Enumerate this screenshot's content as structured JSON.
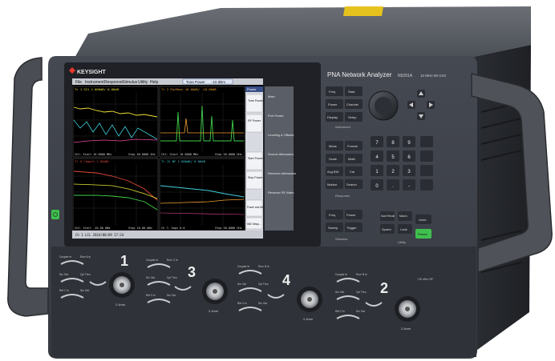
{
  "brand": "KEYSIGHT",
  "model": {
    "name": "PNA Network Analyzer",
    "number": "N5291A",
    "range": "10 MHz-50 GHz"
  },
  "screen": {
    "menu": [
      "File",
      "Instrument",
      "Response",
      "Stimulus",
      "Utility",
      "Help"
    ],
    "power_field": {
      "label": "Tone Power",
      "value": "-10 dBm"
    },
    "softkey_header": {
      "title": "Power",
      "selector": "IMD"
    },
    "softkeys": [
      "Tone Power",
      "RF Power",
      "Start Power",
      "Stop Power",
      "Power and Attenuators...",
      "IMD Setup..."
    ],
    "side_labels": [
      "Main",
      "Port Power",
      "Leveling & Offsets",
      "Source Attenuator",
      "Receiver Attenuator",
      "Receiver RF Atten"
    ],
    "panels": [
      {
        "title": "Tr 1 S21 1.000dB/ 0.00dB",
        "footer": "Ch1: Start 10.0000 MHz",
        "stop": "Stop 50.0000 GHz",
        "color": "#f2e33a"
      },
      {
        "title": "Tr 2 PwrMain 10.00dB/ -10.00dB",
        "footer": "Ch2: Start 10.0000 MHz",
        "stop": "Stop 50.0000 GHz",
        "color": "#f0a030"
      },
      {
        "title": "Tr 5 Comp21 1.00dB/",
        "footer": "Ch3: Start -20.00 dBm",
        "stop": "Stop 10.00 dBm",
        "color": "#e64a3a"
      },
      {
        "title": "Tr 12 NF 1.000dB/ 0.00dB",
        "footer": "Ch 7: Swps 0.0",
        "stop": "Stop 50.0000 GHz",
        "color": "#3fd0e0"
      }
    ],
    "status": "Ch 1 LCL 2024/08/09 17:24"
  },
  "front_panel": {
    "key_rows": [
      [
        "Freq",
        "Start"
      ],
      [
        "Power",
        "Channel"
      ],
      [
        "Display",
        "Setup"
      ]
    ],
    "key_rows_lower": [
      [
        "Meas",
        "Format"
      ],
      [
        "Scale",
        "Math"
      ],
      [
        "Avg BW",
        "Cal"
      ],
      [
        "Marker",
        "Search"
      ],
      [
        "Freq",
        "Power"
      ],
      [
        "Sweep",
        "Trigger"
      ]
    ],
    "keypad": [
      "7",
      "8",
      "9",
      "4",
      "5",
      "6",
      "1",
      "2",
      "3",
      "0",
      ".",
      "-"
    ],
    "section_labels": {
      "instrument": "Instrument",
      "response": "Response",
      "stimulus": "Stimulus",
      "utility": "Utility"
    },
    "preset_label": "Preset",
    "undo_label": "Undo",
    "util_keys": [
      "Save Recall",
      "Macro",
      "System",
      "Local"
    ]
  },
  "ports": [
    {
      "number": "1",
      "connector": "2.4mm",
      "jumpers": [
        "Coupler In",
        "Rcvr A In",
        "Src Out",
        "Cpl Thru",
        "Ref 1 In",
        "Src Out"
      ]
    },
    {
      "number": "3",
      "connector": "2.4mm",
      "jumpers": [
        "Coupler In",
        "Rcvr C In",
        "Src Out",
        "Cpl Thru",
        "Ref 3 In",
        "Src Out"
      ]
    },
    {
      "number": "4",
      "connector": "2.4mm",
      "jumpers": [
        "Coupler In",
        "Rcvr D In",
        "Src Out",
        "Cpl Thru",
        "Ref 4 In",
        "Src Out"
      ]
    },
    {
      "number": "2",
      "connector": "2.4mm",
      "jumpers": [
        "Coupler In",
        "Rcvr B In",
        "Src Out",
        "Cpl Thru",
        "Ref 2 In",
        "Src Out"
      ]
    }
  ],
  "port_caption": "+30 dBm RF",
  "colors": {
    "body": "#3b3f47",
    "panel": "#2a2d33",
    "screen_bg": "#000000",
    "accent_green": "#3fbf4f",
    "handle": "#46494f"
  }
}
